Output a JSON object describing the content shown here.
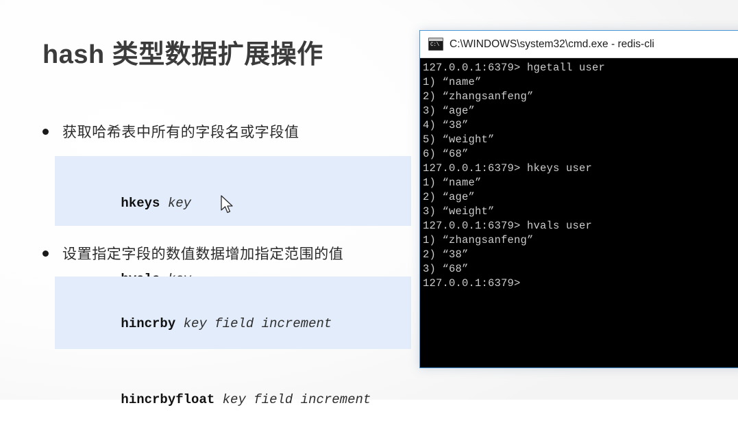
{
  "slide": {
    "title": "hash 类型数据扩展操作",
    "bullets": [
      {
        "text": "获取哈希表中所有的字段名或字段值"
      },
      {
        "text": "设置指定字段的数值数据增加指定范围的值"
      }
    ],
    "code_blocks": [
      {
        "lines": [
          {
            "command": "hkeys",
            "args": " key"
          },
          {
            "command": "hvals",
            "args": " key"
          }
        ]
      },
      {
        "lines": [
          {
            "command": "hincrby",
            "args": " key field increment"
          },
          {
            "command": "hincrbyfloat",
            "args": " key field increment"
          }
        ]
      }
    ]
  },
  "cmd_window": {
    "title": "C:\\WINDOWS\\system32\\cmd.exe - redis-cli",
    "icon": "console-icon",
    "colors": {
      "border": "#4a95d6",
      "terminal_background": "#000000",
      "terminal_foreground": "#cccccc",
      "code_block_background": "#e2ecfa"
    },
    "terminal_lines": [
      "127.0.0.1:6379> hgetall user",
      "1) “name”",
      "2) “zhangsanfeng”",
      "3) “age”",
      "4) “38”",
      "5) “weight”",
      "6) “68”",
      "127.0.0.1:6379> hkeys user",
      "1) “name”",
      "2) “age”",
      "3) “weight”",
      "127.0.0.1:6379> hvals user",
      "1) “zhangsanfeng”",
      "2) “38”",
      "3) “68”",
      "127.0.0.1:6379>"
    ]
  }
}
